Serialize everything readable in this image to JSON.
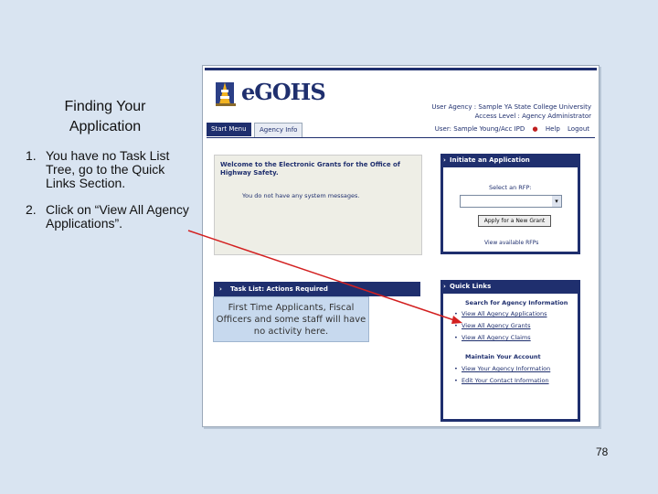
{
  "slide": {
    "title_line1": "Finding Your",
    "title_line2": "Application",
    "steps": [
      {
        "num": "1.",
        "text": "You have no Task List Tree, go to the Quick Links Section."
      },
      {
        "num": "2.",
        "text": "Click on “View All Agency Applications”."
      }
    ],
    "page_number": "78",
    "callout": "First Time Applicants, Fiscal Officers and some staff will have no activity here."
  },
  "app": {
    "logo_text": "eGOHS",
    "user_agency": "User Agency : Sample YA State College University",
    "access_level": "Access Level : Agency Administrator",
    "tabs": [
      "Start Menu",
      "Agency Info"
    ],
    "user": "User: Sample Young/Acc IPD",
    "help": "Help",
    "logout": "Logout",
    "welcome_title": "Welcome to the Electronic Grants for the Office of Highway Safety.",
    "welcome_msg": "You do not have any system messages.",
    "initiate": {
      "title": "Initiate an Application",
      "select_label": "Select an RFP:",
      "apply_button": "Apply for a New Grant",
      "view_rfps": "View available RFPs"
    },
    "task_list_title": "Task List: Actions Required",
    "quick_links": {
      "title": "Quick Links",
      "search_header": "Search for Agency Information",
      "search_links": [
        "View All Agency Applications",
        "View All Agency Grants",
        "View All Agency Claims"
      ],
      "account_header": "Maintain Your Account",
      "account_links": [
        "View Your Agency Information",
        "Edit Your Contact Information"
      ]
    }
  },
  "colors": {
    "slide_bg": "#d9e4f1",
    "app_navy": "#1f2f6e",
    "callout_bg": "#c7d9ee",
    "arrow": "#d32020"
  }
}
